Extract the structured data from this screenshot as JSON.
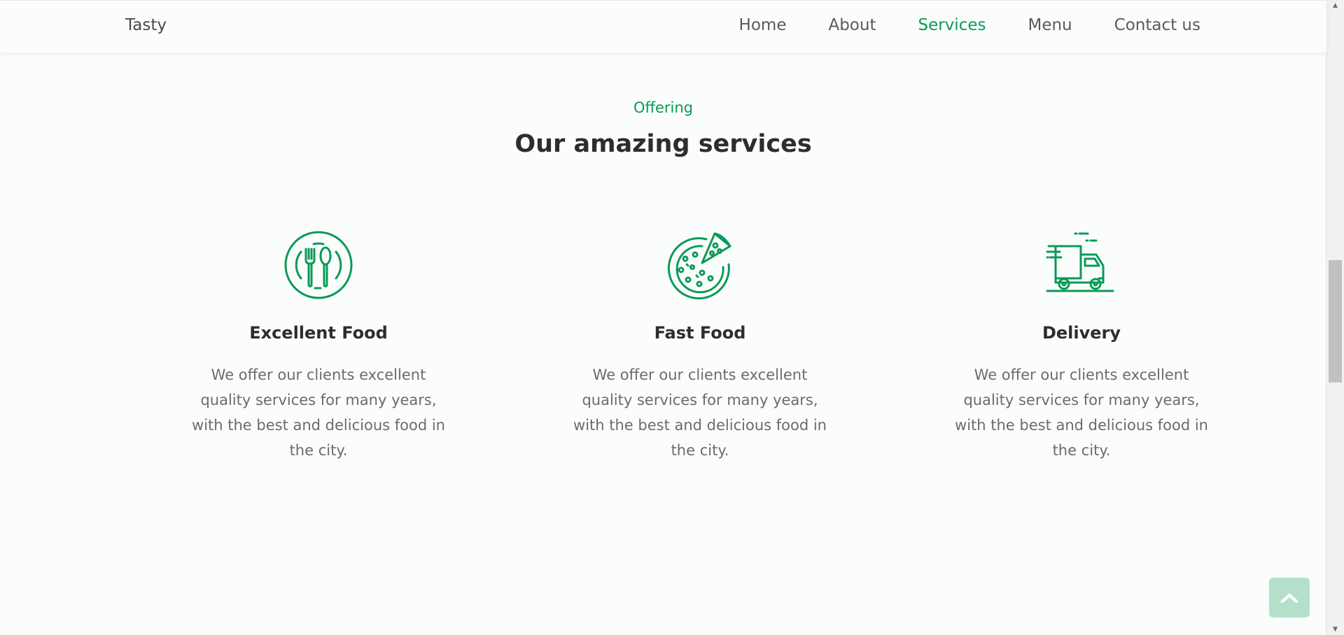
{
  "header": {
    "logo": "Tasty",
    "nav": [
      {
        "label": "Home"
      },
      {
        "label": "About"
      },
      {
        "label": "Services",
        "active": true
      },
      {
        "label": "Menu"
      },
      {
        "label": "Contact us"
      }
    ]
  },
  "services": {
    "subtitle": "Offering",
    "title": "Our amazing services",
    "cards": [
      {
        "icon": "dining-plate-icon",
        "title": "Excellent Food",
        "description": "We offer our clients excellent quality services for many years, with the best and delicious food in the city."
      },
      {
        "icon": "pizza-icon",
        "title": "Fast Food",
        "description": "We offer our clients excellent quality services for many years, with the best and delicious food in the city."
      },
      {
        "icon": "delivery-truck-icon",
        "title": "Delivery",
        "description": "We offer our clients excellent quality services for many years, with the best and delicious food in the city."
      }
    ]
  },
  "colors": {
    "accent": "#0a9a57",
    "heading": "#2d2d2d",
    "body_text": "#6b6b6b",
    "background": "#fbfdfc",
    "back_to_top": "#b4e0cb"
  },
  "back_to_top": {
    "icon": "chevron-up-icon"
  }
}
